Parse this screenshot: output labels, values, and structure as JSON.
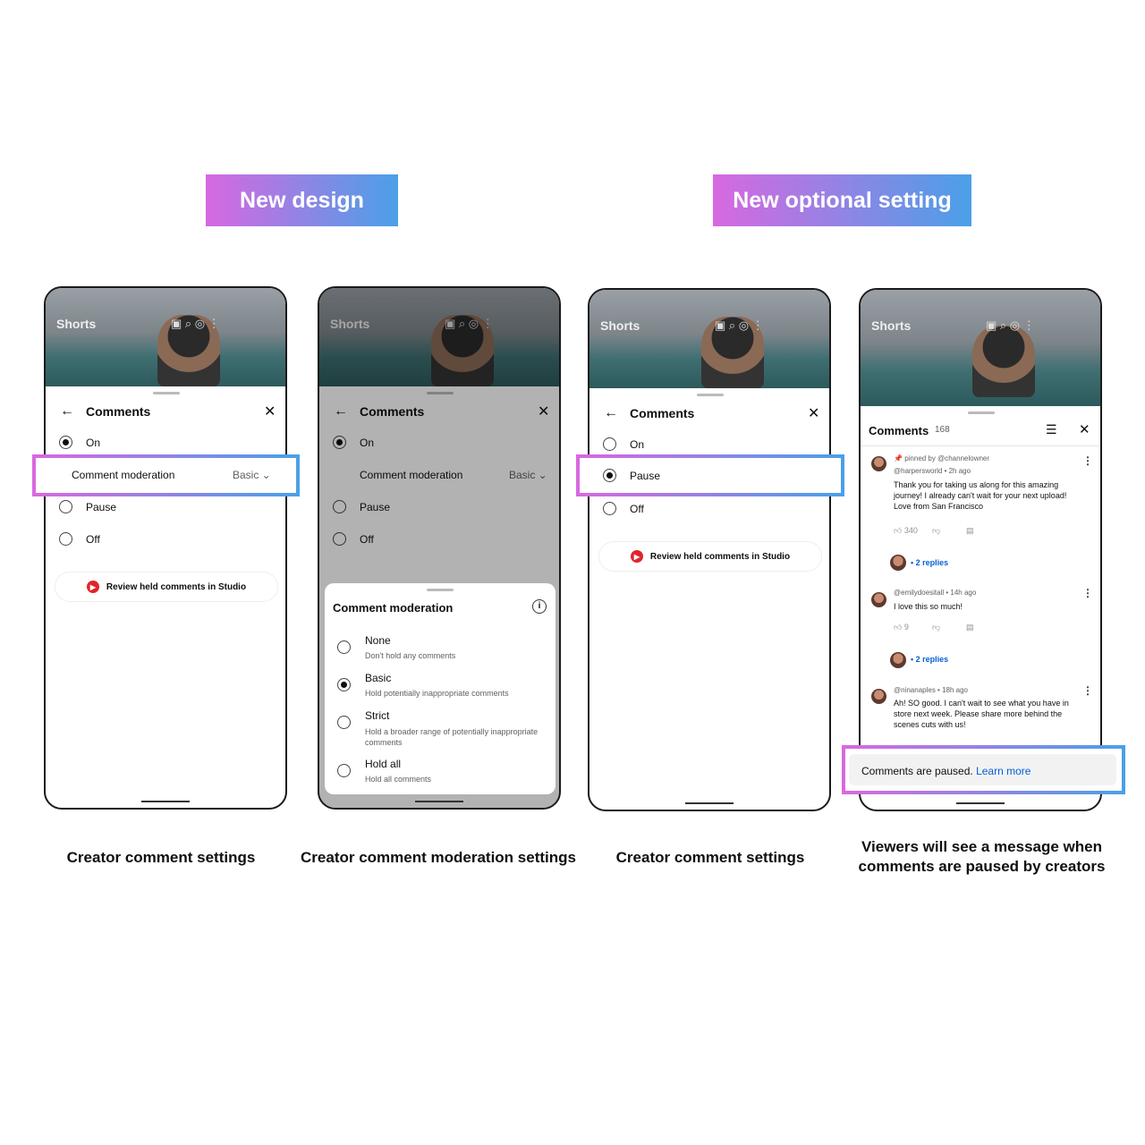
{
  "banners": {
    "left": "New design",
    "right": "New optional setting"
  },
  "video": {
    "label": "Shorts"
  },
  "phone1": {
    "title": "Comments",
    "on": "On",
    "moderation": "Comment moderation",
    "moderation_value": "Basic",
    "pause": "Pause",
    "off": "Off",
    "review": "Review held comments in Studio",
    "caption": "Creator comment settings"
  },
  "phone2": {
    "title": "Comments",
    "on": "On",
    "moderation": "Comment moderation",
    "moderation_value": "Basic",
    "pause": "Pause",
    "off": "Off",
    "sheet_title": "Comment moderation",
    "options": [
      {
        "label": "None",
        "desc": "Don't hold any comments",
        "selected": false
      },
      {
        "label": "Basic",
        "desc": "Hold potentially inappropriate comments",
        "selected": true
      },
      {
        "label": "Strict",
        "desc": "Hold a broader range of potentially inappropriate comments",
        "selected": false
      },
      {
        "label": "Hold all",
        "desc": "Hold all comments",
        "selected": false
      }
    ],
    "caption": "Creator comment moderation settings"
  },
  "phone3": {
    "title": "Comments",
    "on": "On",
    "pause": "Pause",
    "off": "Off",
    "review": "Review held comments in Studio",
    "caption": "Creator comment settings"
  },
  "phone4": {
    "title": "Comments",
    "count": "168",
    "comments": [
      {
        "pinned": "pinned by @channelowner",
        "meta": "@harpersworld • 2h ago",
        "text": "Thank you for taking us along for this amazing journey! I already can't wait for your next upload! Love from San Francisco",
        "likes": "340",
        "replies": "• 2 replies"
      },
      {
        "meta": "@emilydoesitall • 14h ago",
        "text": "I love this so much!",
        "likes": "9",
        "replies": "• 2 replies"
      },
      {
        "meta": "@ninanaples  •  18h ago",
        "text": "Ah! SO good. I can't wait to see what you have in store next week. Please share more behind the scenes cuts with us!"
      }
    ],
    "paused": "Comments are paused.",
    "learn_more": "Learn more",
    "caption": "Viewers will see a message when comments are paused by creators"
  }
}
